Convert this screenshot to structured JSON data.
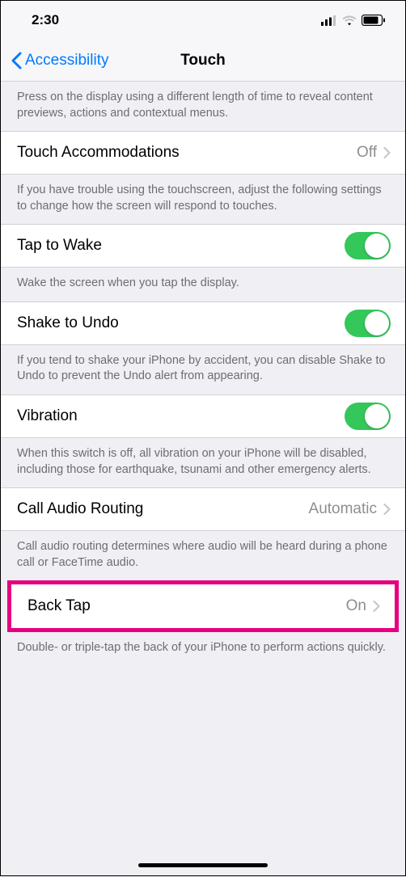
{
  "status": {
    "time": "2:30"
  },
  "nav": {
    "back_label": "Accessibility",
    "title": "Touch"
  },
  "sections": {
    "haptic_touch_footer": "Press on the display using a different length of time to reveal content previews, actions and contextual menus.",
    "touch_accommodations": {
      "label": "Touch Accommodations",
      "value": "Off",
      "footer": "If you have trouble using the touchscreen, adjust the following settings to change how the screen will respond to touches."
    },
    "tap_to_wake": {
      "label": "Tap to Wake",
      "on": true,
      "footer": "Wake the screen when you tap the display."
    },
    "shake_to_undo": {
      "label": "Shake to Undo",
      "on": true,
      "footer": "If you tend to shake your iPhone by accident, you can disable Shake to Undo to prevent the Undo alert from appearing."
    },
    "vibration": {
      "label": "Vibration",
      "on": true,
      "footer": "When this switch is off, all vibration on your iPhone will be disabled, including those for earthquake, tsunami and other emergency alerts."
    },
    "call_audio": {
      "label": "Call Audio Routing",
      "value": "Automatic",
      "footer": "Call audio routing determines where audio will be heard during a phone call or FaceTime audio."
    },
    "back_tap": {
      "label": "Back Tap",
      "value": "On",
      "footer": "Double- or triple-tap the back of your iPhone to perform actions quickly."
    }
  }
}
